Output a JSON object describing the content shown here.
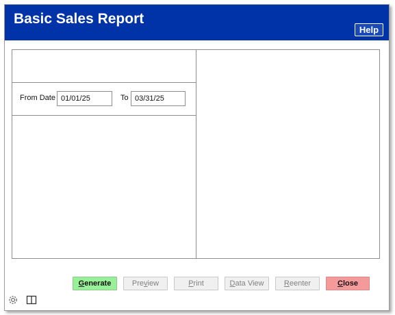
{
  "window": {
    "title": "Basic Sales Report",
    "help_label": "Help",
    "accent_color": "#0033a8"
  },
  "filters": {
    "from_label": "From Date",
    "from_value": "01/01/25",
    "to_label": "To",
    "to_value": "03/31/25"
  },
  "buttons": {
    "generate": {
      "first": "G",
      "rest": "enerate",
      "enabled": true,
      "color": "#98f098"
    },
    "preview": {
      "pre": "Pre",
      "underline": "v",
      "post": "iew",
      "enabled": false
    },
    "print": {
      "first": "P",
      "rest": "rint",
      "enabled": false
    },
    "dataview": {
      "first": "D",
      "rest": "ata View",
      "enabled": false
    },
    "reenter": {
      "first": "R",
      "rest": "eenter",
      "enabled": false
    },
    "close": {
      "first": "C",
      "rest": "lose",
      "enabled": true,
      "color": "#f59a9a"
    }
  },
  "footer_icons": [
    "gear-icon",
    "book-icon"
  ]
}
